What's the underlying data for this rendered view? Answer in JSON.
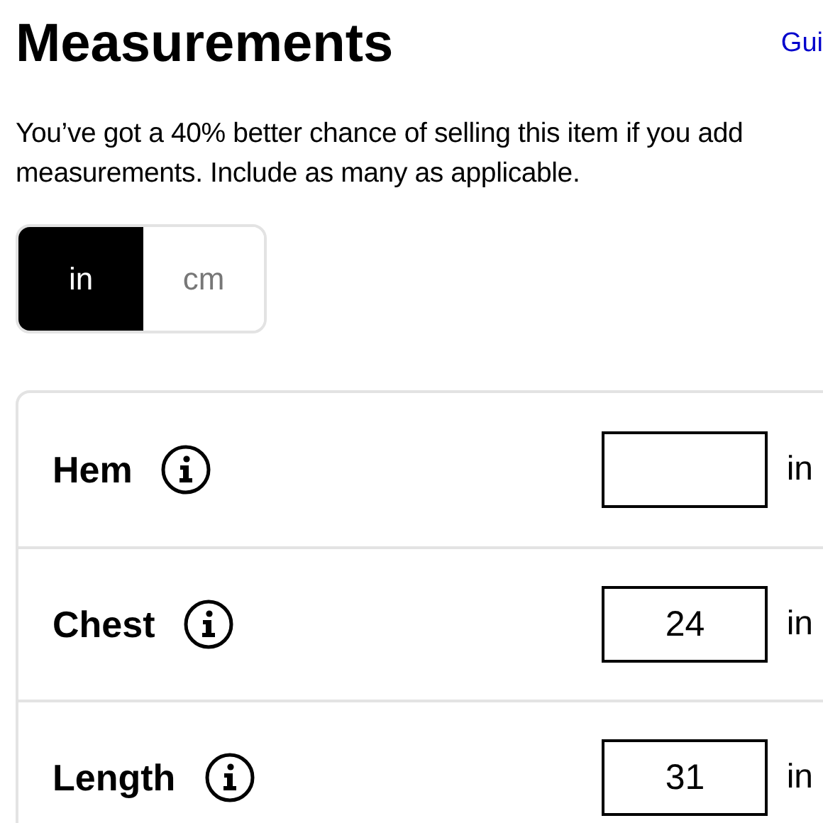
{
  "header": {
    "title": "Measurements",
    "guide_link": "Gui"
  },
  "intro": "You’ve got a 40% better chance of selling this item if you add measurements. Include as many as applicable.",
  "units": [
    {
      "label": "in",
      "selected": true
    },
    {
      "label": "cm",
      "selected": false
    }
  ],
  "measurements": [
    {
      "label": "Hem",
      "unit": "in"
    },
    {
      "label": "Chest",
      "value": "24",
      "unit": "in"
    },
    {
      "label": "Length",
      "value": "31",
      "unit": "in"
    }
  ]
}
